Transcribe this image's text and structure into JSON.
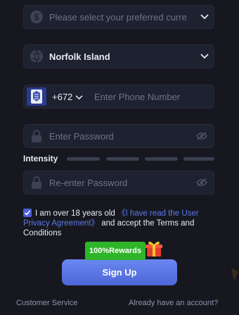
{
  "currency": {
    "placeholder": "Please select your preferred curre"
  },
  "country": {
    "value": "Norfolk Island"
  },
  "phone": {
    "code": "+672",
    "placeholder": "Enter Phone Number"
  },
  "password": {
    "placeholder": "Enter Password"
  },
  "intensity": {
    "label": "Intensity",
    "level": 0
  },
  "repassword": {
    "placeholder": "Re-enter Password"
  },
  "agreement": {
    "checked": true,
    "prefix": "I am over 18 years old",
    "link": "《I have read the User Privacy Agreement》",
    "suffix": "and accept the Terms and Conditions"
  },
  "rewards_badge": "100%Rewards",
  "signup_label": "Sign Up",
  "footer": {
    "customer_service": "Customer Service",
    "already_account": "Already have an account?"
  },
  "colors": {
    "background": "#17181f",
    "field": "#1e2130",
    "accent": "#5b78e6",
    "rewards": "#2fb52a"
  },
  "icons": [
    "dollar-icon",
    "globe-icon",
    "flag-icon",
    "chevron-down-icon",
    "lock-icon",
    "eye-off-icon",
    "check-icon",
    "gift-icon"
  ]
}
